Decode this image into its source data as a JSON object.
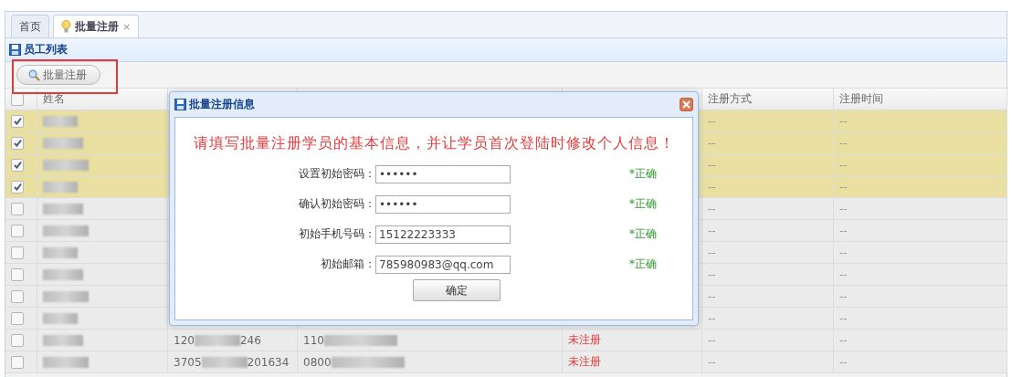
{
  "tabs": [
    {
      "label": "首页",
      "selected": false
    },
    {
      "label": "批量注册",
      "selected": true,
      "close": "×"
    }
  ],
  "panel": {
    "title": "员工列表"
  },
  "toolbar": {
    "button": "批量注册"
  },
  "table": {
    "header_checked": false,
    "columns": [
      {
        "label": "姓名"
      },
      {
        "label": "注册方式"
      },
      {
        "label": "注册时间"
      }
    ],
    "rows": [
      {
        "selected": true,
        "method": "--",
        "time": "--"
      },
      {
        "selected": true,
        "method": "--",
        "time": "--"
      },
      {
        "selected": true,
        "method": "--",
        "time": "--"
      },
      {
        "selected": true,
        "method": "--",
        "time": "--"
      },
      {
        "selected": false,
        "method": "--",
        "time": "--"
      },
      {
        "selected": false,
        "method": "--",
        "time": "--"
      },
      {
        "selected": false,
        "method": "--",
        "time": "--"
      },
      {
        "selected": false,
        "method": "--",
        "time": "--"
      },
      {
        "selected": false,
        "method": "--",
        "time": "--"
      },
      {
        "selected": false,
        "method": "--",
        "time": "--"
      },
      {
        "selected": false,
        "id_start": "120",
        "id_end": "246",
        "code_start": "110",
        "status": "未注册",
        "method": "--",
        "time": "--"
      },
      {
        "selected": false,
        "id_start": "3705",
        "id_end": "201634",
        "code_start": "0800",
        "status": "未注册",
        "method": "--",
        "time": "--"
      }
    ]
  },
  "dialog": {
    "title": "批量注册信息",
    "message": "请填写批量注册学员的基本信息，并让学员首次登陆时修改个人信息！",
    "fields": [
      {
        "label": "设置初始密码：",
        "value": "••••••",
        "hint": "*正确"
      },
      {
        "label": "确认初始密码：",
        "value": "••••••",
        "hint": "*正确"
      },
      {
        "label": "初始手机号码：",
        "value": "15122223333",
        "hint": "*正确"
      },
      {
        "label": "初始邮箱：",
        "value": "785980983@qq.com",
        "hint": "*正确"
      }
    ],
    "confirm": "确定"
  }
}
